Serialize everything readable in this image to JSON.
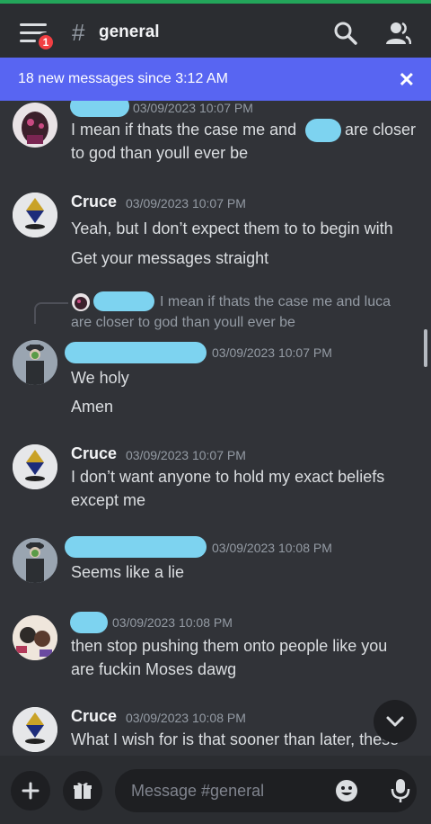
{
  "header": {
    "notification_count": "1",
    "hash_symbol": "#",
    "channel_name": "general",
    "search_icon": "search-icon",
    "members_icon": "members-icon"
  },
  "banner": {
    "text": "18 new messages since 3:12 AM",
    "close": "✕"
  },
  "messages": [
    {
      "author": "",
      "time": "03/09/2023 10:07 PM",
      "lines": [
        "I mean if thats the case me and",
        "are closer",
        "to god than youll ever be"
      ]
    },
    {
      "author": "Cruce",
      "time": "03/09/2023 10:07 PM",
      "lines": [
        "Yeah, but I don’t expect them to to begin with",
        "Get your messages straight"
      ]
    },
    {
      "reply_preview": [
        "I mean if thats the case me and luca",
        "are closer to god than youll ever be"
      ],
      "author": "",
      "time": "03/09/2023 10:07 PM",
      "lines": [
        "We holy",
        "Amen"
      ]
    },
    {
      "author": "Cruce",
      "time": "03/09/2023 10:07 PM",
      "lines": [
        "I don’t want anyone to hold my exact beliefs",
        "except me"
      ]
    },
    {
      "author": "",
      "time": "03/09/2023 10:08 PM",
      "lines": [
        "Seems like a lie"
      ]
    },
    {
      "author": "",
      "time": "03/09/2023 10:08 PM",
      "lines": [
        "then stop pushing them onto people like you",
        "are fuckin Moses dawg"
      ]
    },
    {
      "author": "Cruce",
      "time": "03/09/2023 10:08 PM",
      "lines": [
        "What I wish for is that sooner than later, these"
      ]
    }
  ],
  "composer": {
    "placeholder": "Message #general",
    "add_icon": "plus-icon",
    "gift_icon": "gift-icon",
    "emoji_icon": "emoji-icon",
    "mic_icon": "microphone-icon"
  },
  "colors": {
    "background": "#313338",
    "header": "#2b2d31",
    "banner": "#5865f2",
    "redaction": "#7dd3f0",
    "badge": "#f23f43"
  }
}
